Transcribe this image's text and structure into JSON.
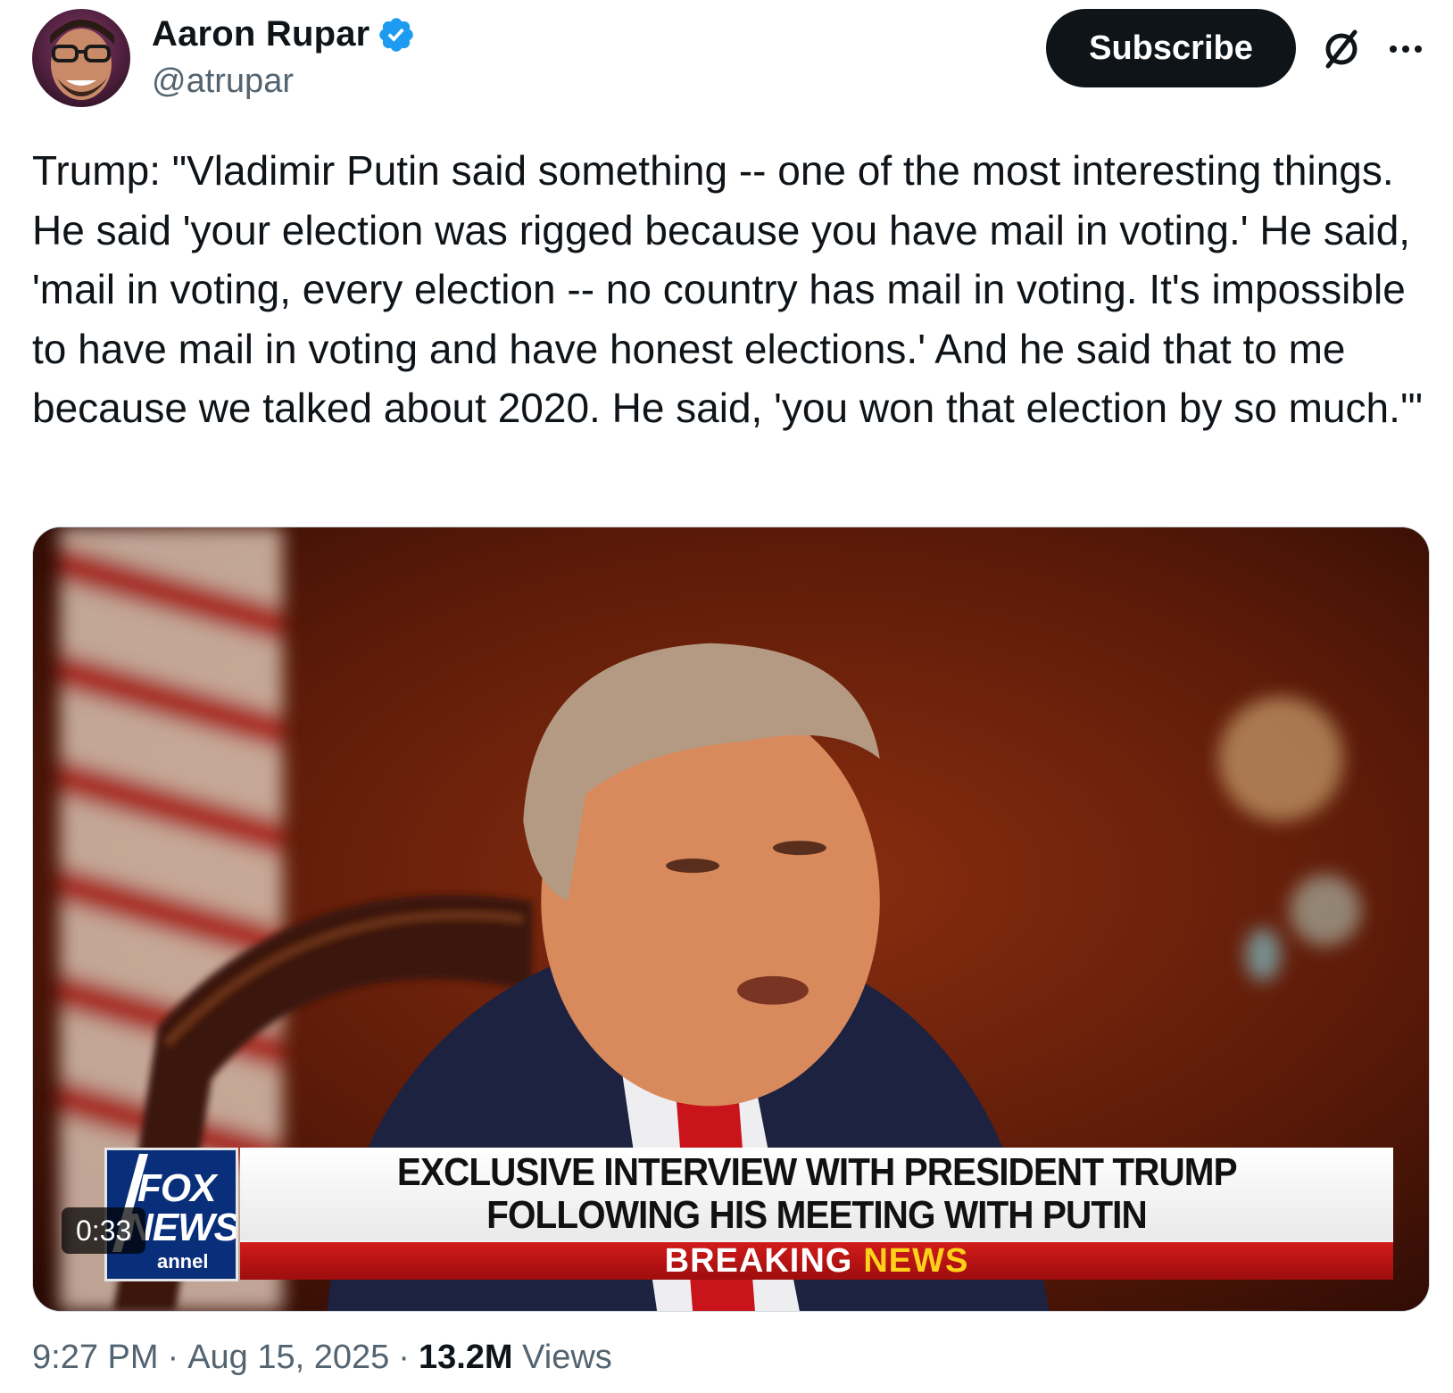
{
  "author": {
    "display_name": "Aaron Rupar",
    "handle": "@atrupar",
    "verified": true,
    "verified_color": "#1d9bf0"
  },
  "actions": {
    "subscribe_label": "Subscribe",
    "grok_icon": "grok-icon",
    "more_icon": "more-icon"
  },
  "tweet": {
    "text": "Trump: \"Vladimir Putin said something -- one of the most interesting things. He said 'your election was rigged because you have mail in voting.' He said, 'mail in voting, every election -- no country has mail in voting. It's impossible to have mail in voting and have honest elections.' And he said that to me because we talked about 2020. He said, 'you won that election by so much.'\""
  },
  "video": {
    "duration": "0:33",
    "chyron": {
      "logo_line1": "FOX",
      "logo_line2": "NEWS",
      "logo_line3": "annel",
      "headline_line1": "EXCLUSIVE INTERVIEW WITH PRESIDENT TRUMP",
      "headline_line2": "FOLLOWING HIS MEETING WITH PUTIN",
      "breaking_word1": "BREAKING",
      "breaking_word2": "NEWS"
    }
  },
  "meta": {
    "time": "9:27 PM",
    "separator": "·",
    "date": "Aug 15, 2025",
    "views_count": "13.2M",
    "views_label": "Views"
  },
  "colors": {
    "text_primary": "#0f1419",
    "text_secondary": "#536471",
    "button_bg": "#0f1419",
    "breaking_red": "#c8161a",
    "breaking_yellow": "#ffd21a",
    "fox_blue": "#0a2f7a"
  }
}
